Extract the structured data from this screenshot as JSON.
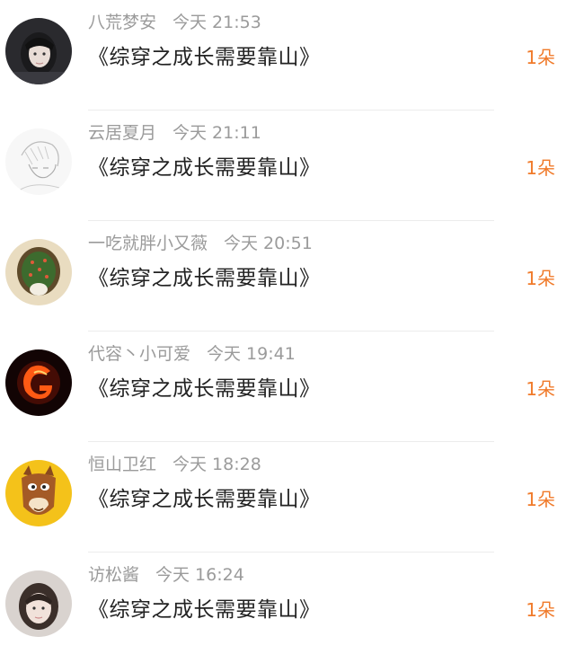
{
  "comments": [
    {
      "name": "八荒梦安",
      "time": "今天  21:53",
      "title": "《综穿之成长需要靠山》",
      "count": "1朵",
      "avatar": "avatar-girl-dark-hair"
    },
    {
      "name": "云居夏月",
      "time": "今天  21:11",
      "title": "《综穿之成长需要靠山》",
      "count": "1朵",
      "avatar": "avatar-anime-sketch"
    },
    {
      "name": "一吃就胖小又薇",
      "time": "今天  20:51",
      "title": "《综穿之成长需要靠山》",
      "count": "1朵",
      "avatar": "avatar-cactus-cake"
    },
    {
      "name": "代容丶小可爱",
      "time": "今天  19:41",
      "title": "《综穿之成长需要靠山》",
      "count": "1朵",
      "avatar": "avatar-fire-letter"
    },
    {
      "name": "恒山卫红",
      "time": "今天  18:28",
      "title": "《综穿之成长需要靠山》",
      "count": "1朵",
      "avatar": "avatar-cartoon-horse"
    },
    {
      "name": "访松酱",
      "time": "今天  16:24",
      "title": "《综穿之成长需要靠山》",
      "count": "1朵",
      "avatar": "avatar-girl-photo"
    }
  ],
  "colors": {
    "count": "#f07a2a",
    "meta": "#9b9b9b",
    "title": "#222222"
  }
}
